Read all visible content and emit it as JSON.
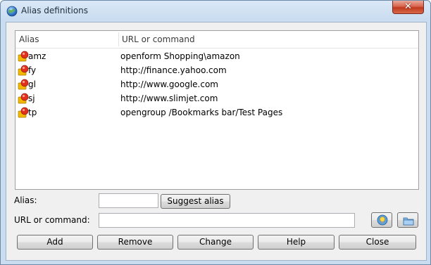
{
  "window": {
    "title": "Alias definitions",
    "close_label": "✕"
  },
  "list": {
    "columns": [
      "Alias",
      "URL or command"
    ],
    "rows": [
      {
        "alias": "amz",
        "url": "openform Shopping\\amazon"
      },
      {
        "alias": "fy",
        "url": "http://finance.yahoo.com"
      },
      {
        "alias": "gl",
        "url": "http://www.google.com"
      },
      {
        "alias": "sj",
        "url": "http://www.slimjet.com"
      },
      {
        "alias": "tp",
        "url": "opengroup /Bookmarks bar/Test Pages"
      }
    ]
  },
  "form": {
    "alias_label": "Alias:",
    "alias_value": "",
    "suggest_label": "Suggest alias",
    "url_label": "URL or command:",
    "url_value": ""
  },
  "buttons": {
    "add": "Add",
    "remove": "Remove",
    "change": "Change",
    "help": "Help",
    "close": "Close"
  },
  "icons": {
    "title": "globe-icon",
    "row": "alias-item-icon",
    "pick_icon": "lightbulb-icon",
    "browse": "folder-icon"
  }
}
